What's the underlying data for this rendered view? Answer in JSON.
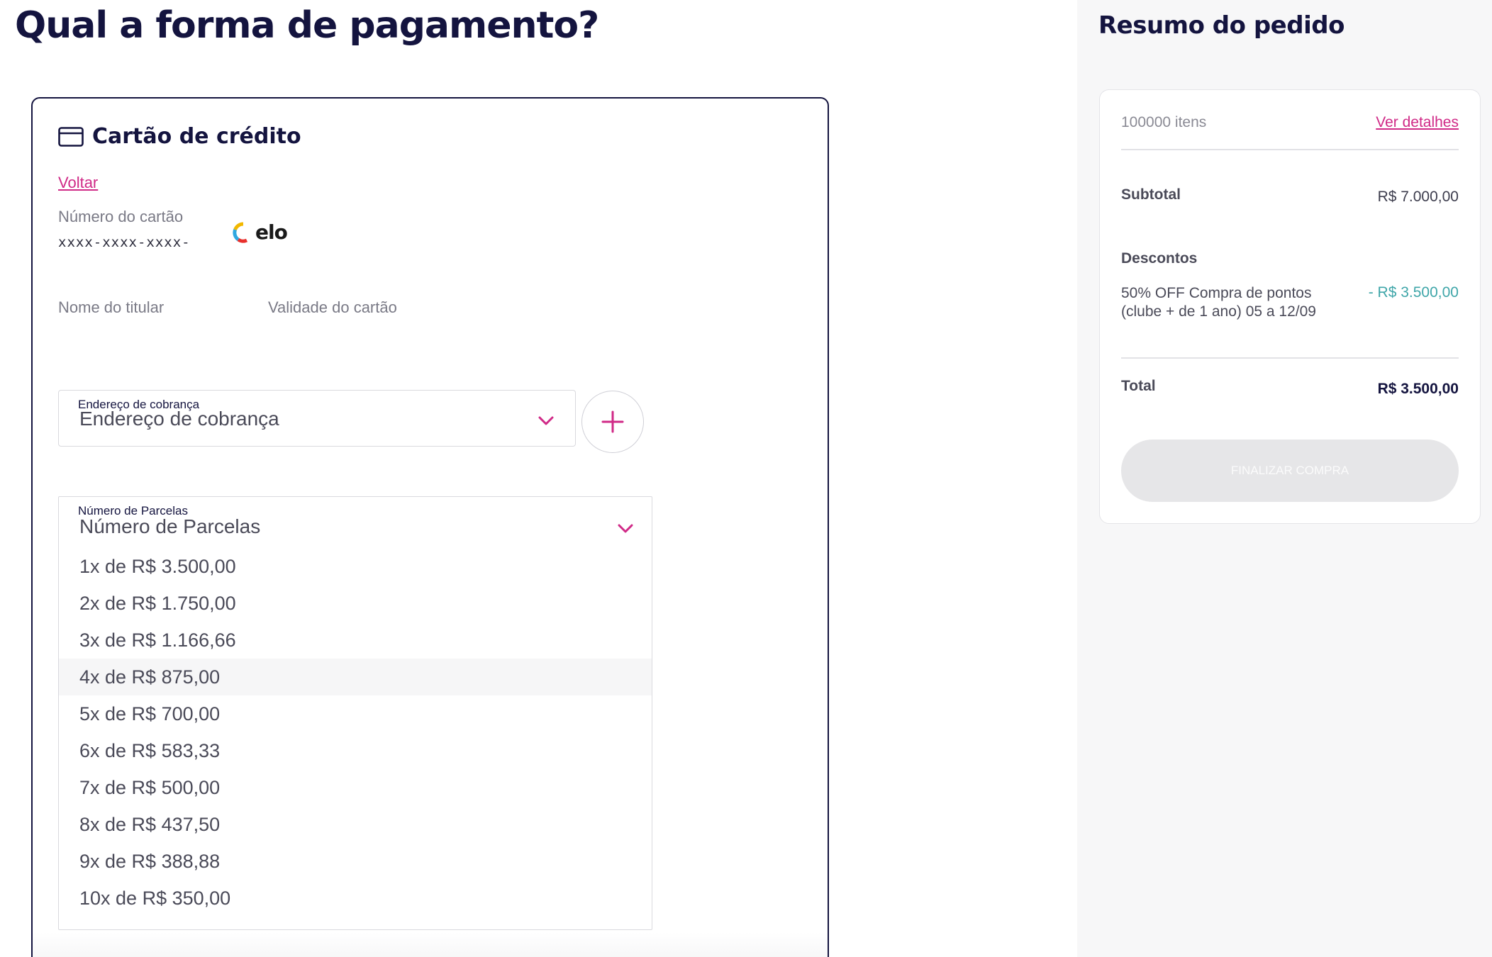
{
  "page": {
    "title": "Qual a forma de pagamento?"
  },
  "payment": {
    "method_title": "Cartão de crédito",
    "back_label": "Voltar",
    "card_number_label": "Número do cartão",
    "card_number_value": "xxxx-xxxx-xxxx-",
    "brand": "elo",
    "holder_label": "Nome do titular",
    "expiry_label": "Validade do cartão",
    "billing_address": {
      "label": "Endereço de cobrança",
      "value": "Endereço de cobrança"
    },
    "installments": {
      "label": "Número de Parcelas",
      "value": "Número de Parcelas",
      "options": [
        "1x de R$ 3.500,00",
        "2x de R$ 1.750,00",
        "3x de R$ 1.166,66",
        "4x de R$ 875,00",
        "5x de R$ 700,00",
        "6x de R$ 583,33",
        "7x de R$ 500,00",
        "8x de R$ 437,50",
        "9x de R$ 388,88",
        "10x de R$ 350,00"
      ],
      "hovered_option": "4x de R$ 875,00"
    }
  },
  "summary": {
    "title": "Resumo do pedido",
    "items_count": "100000 itens",
    "details_link": "Ver detalhes",
    "subtotal_label": "Subtotal",
    "subtotal_value": "R$ 7.000,00",
    "discounts_label": "Descontos",
    "discount_description": "50% OFF Compra de pontos (clube + de 1 ano) 05 a 12/09",
    "discount_value": "- R$ 3.500,00",
    "total_label": "Total",
    "total_value": "R$ 3.500,00",
    "finish_button": "FINALIZAR COMPRA"
  },
  "colors": {
    "brand_navy": "#14143f",
    "accent_pink": "#d02a87",
    "discount_teal": "#3fa6a9",
    "disabled_button": "#e6e6e8"
  }
}
